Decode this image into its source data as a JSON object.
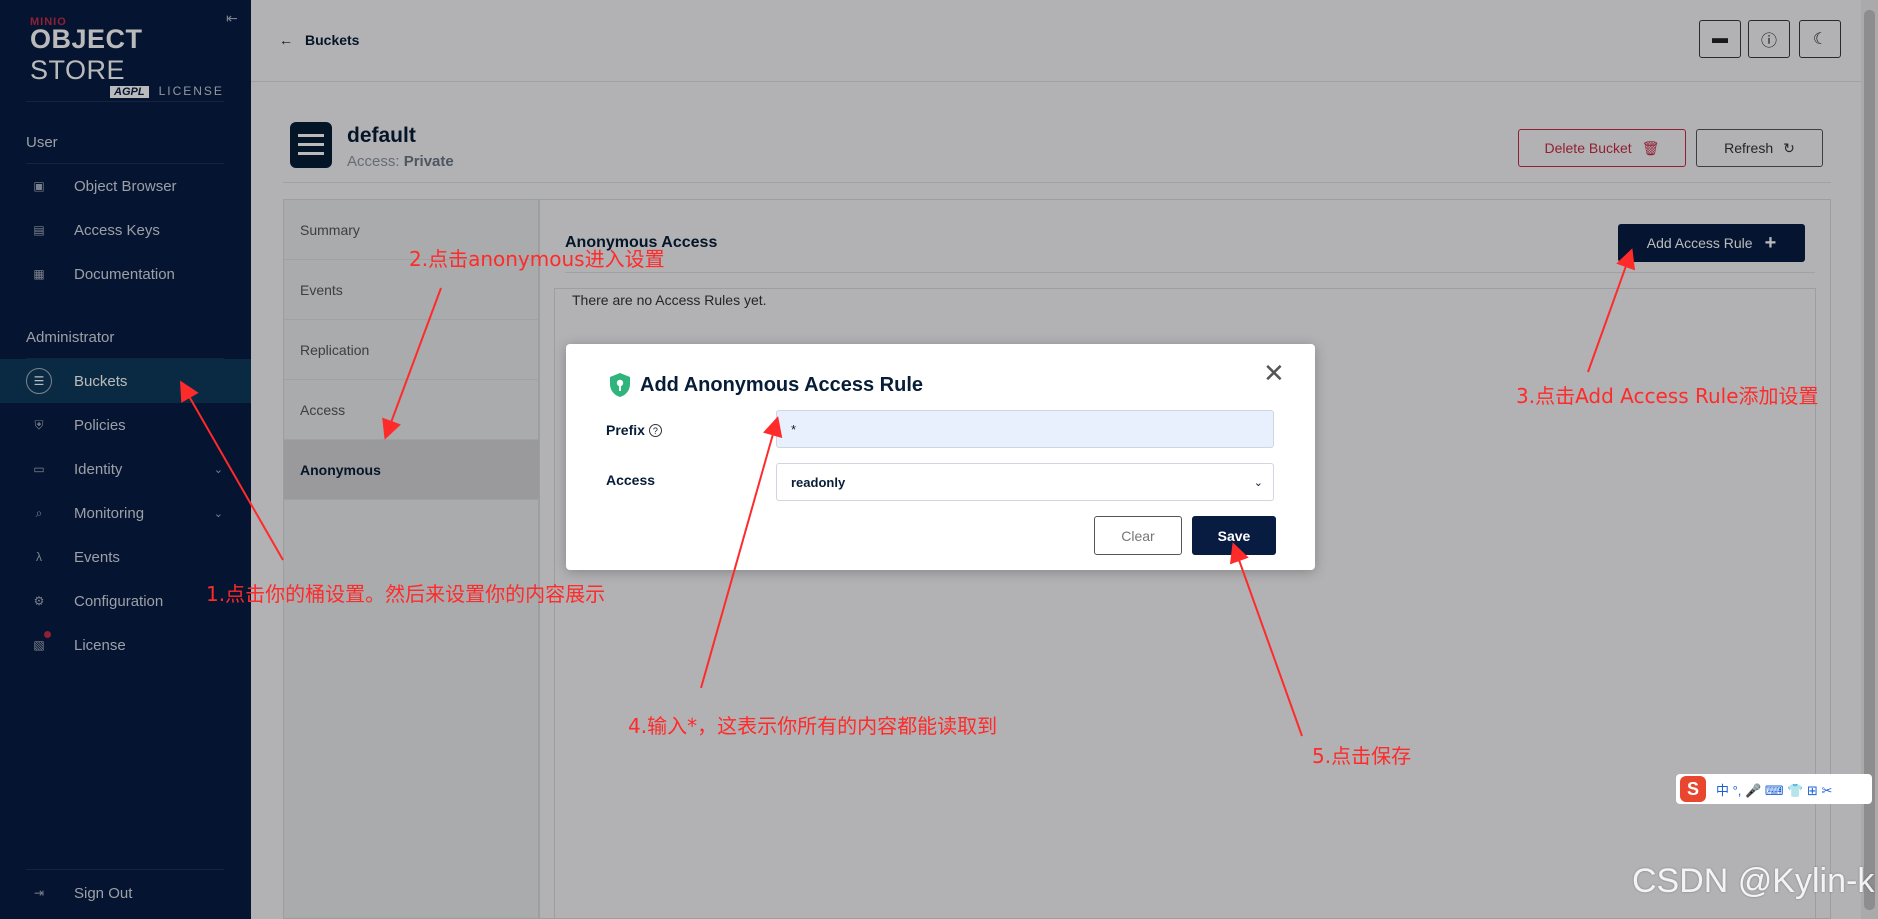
{
  "sidebar": {
    "logo": {
      "brand": "MINIO",
      "product_bold": "OBJECT",
      "product_rest": " STORE",
      "license_badge": "AGPL",
      "license_text": "LICENSE"
    },
    "user_section": "User",
    "admin_section": "Administrator",
    "items": [
      {
        "label": "Object Browser",
        "icon": "object-browser-icon"
      },
      {
        "label": "Access Keys",
        "icon": "access-keys-icon"
      },
      {
        "label": "Documentation",
        "icon": "documentation-icon"
      },
      {
        "label": "Buckets",
        "icon": "buckets-icon"
      },
      {
        "label": "Policies",
        "icon": "policies-icon"
      },
      {
        "label": "Identity",
        "icon": "identity-icon"
      },
      {
        "label": "Monitoring",
        "icon": "monitoring-icon"
      },
      {
        "label": "Events",
        "icon": "events-icon"
      },
      {
        "label": "Configuration",
        "icon": "configuration-icon"
      },
      {
        "label": "License",
        "icon": "license-icon"
      }
    ],
    "sign_out": "Sign Out"
  },
  "header": {
    "back_label": "Buckets"
  },
  "bucket": {
    "name": "default",
    "access_label": "Access: ",
    "access_value": "Private",
    "delete_label": "Delete Bucket",
    "refresh_label": "Refresh"
  },
  "tabs": [
    "Summary",
    "Events",
    "Replication",
    "Access",
    "Anonymous"
  ],
  "content": {
    "title": "Anonymous Access",
    "add_rule_label": "Add Access Rule",
    "empty_text": "There are no Access Rules yet."
  },
  "modal": {
    "title": "Add Anonymous Access Rule",
    "prefix_label": "Prefix",
    "prefix_value": "*",
    "access_label": "Access",
    "access_value": "readonly",
    "clear_label": "Clear",
    "save_label": "Save"
  },
  "annotations": {
    "step1": "1.点击你的桶设置。然后来设置你的内容展示",
    "step2": "2.点击anonymous进入设置",
    "step3": "3.点击Add Access Rule添加设置",
    "step4": "4.输入*，这表示你所有的内容都能读取到",
    "step5": "5.点击保存"
  },
  "ime": {
    "logo": "S",
    "glyphs": "中 °, 🎤 ⌨ 👕 ⊞ ✂"
  },
  "watermark": "CSDN @Kylin-k",
  "colors": {
    "sidebar_bg": "#081c42",
    "accent_red": "#c72c48",
    "annotation_red": "#ff2a2a",
    "primary_button": "#081c42"
  }
}
